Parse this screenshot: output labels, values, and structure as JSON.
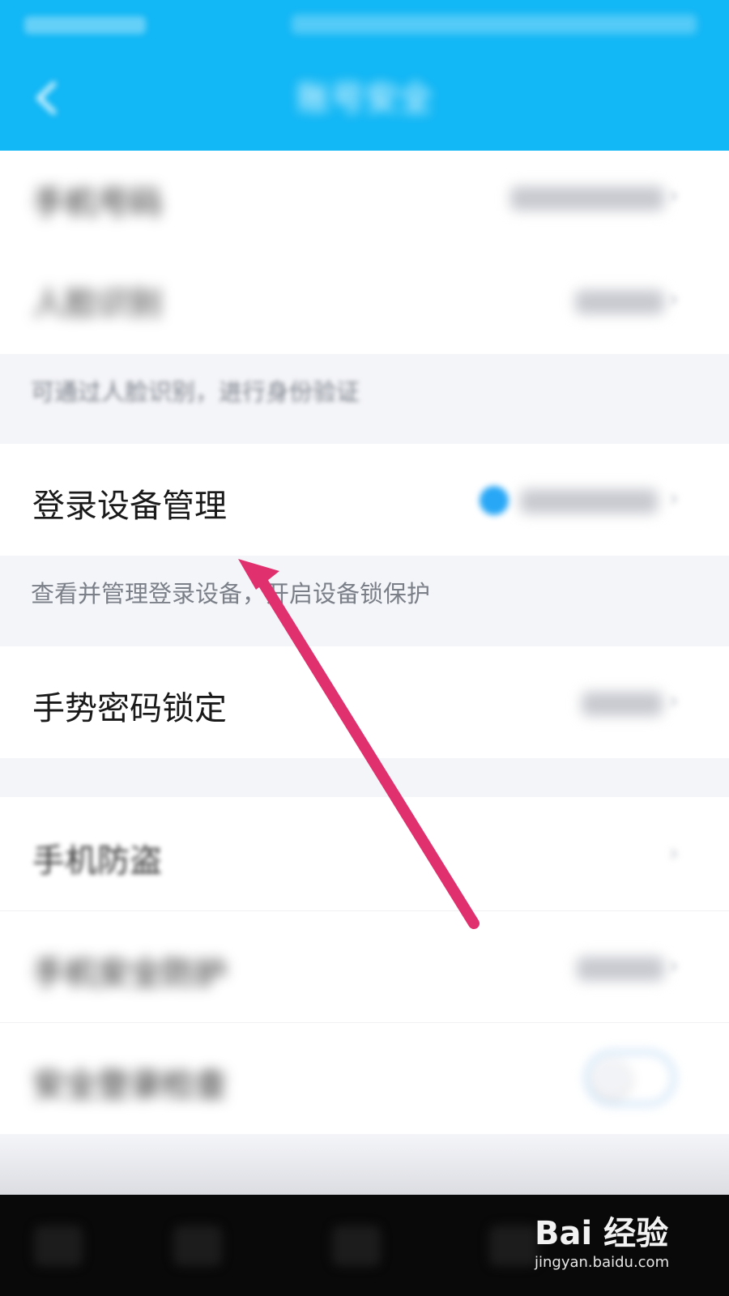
{
  "status_bar": {},
  "header": {
    "title": "账号安全"
  },
  "rows": {
    "phone": {
      "label": "手机号码",
      "value": ""
    },
    "face": {
      "label": "人脸识别",
      "value": ""
    },
    "face_desc": {
      "text": "可通过人脸识别，进行身份验证"
    },
    "login_devices": {
      "label": "登录设备管理",
      "value": ""
    },
    "login_devices_desc": {
      "text": "查看并管理登录设备，开启设备锁保护"
    },
    "gesture_lock": {
      "label": "手势密码锁定",
      "value": ""
    },
    "anti_theft": {
      "label": "手机防盗"
    },
    "security_protect": {
      "label": "手机安全防护",
      "value": ""
    },
    "security_toggle": {
      "label": "安全登录检查",
      "state": "off"
    }
  },
  "watermark": {
    "logo": "Bai 经验",
    "url": "jingyan.baidu.com"
  },
  "colors": {
    "header_bg": "#12b7f5",
    "arrow": "#e0306e",
    "page_bg": "#f4f5f9"
  }
}
